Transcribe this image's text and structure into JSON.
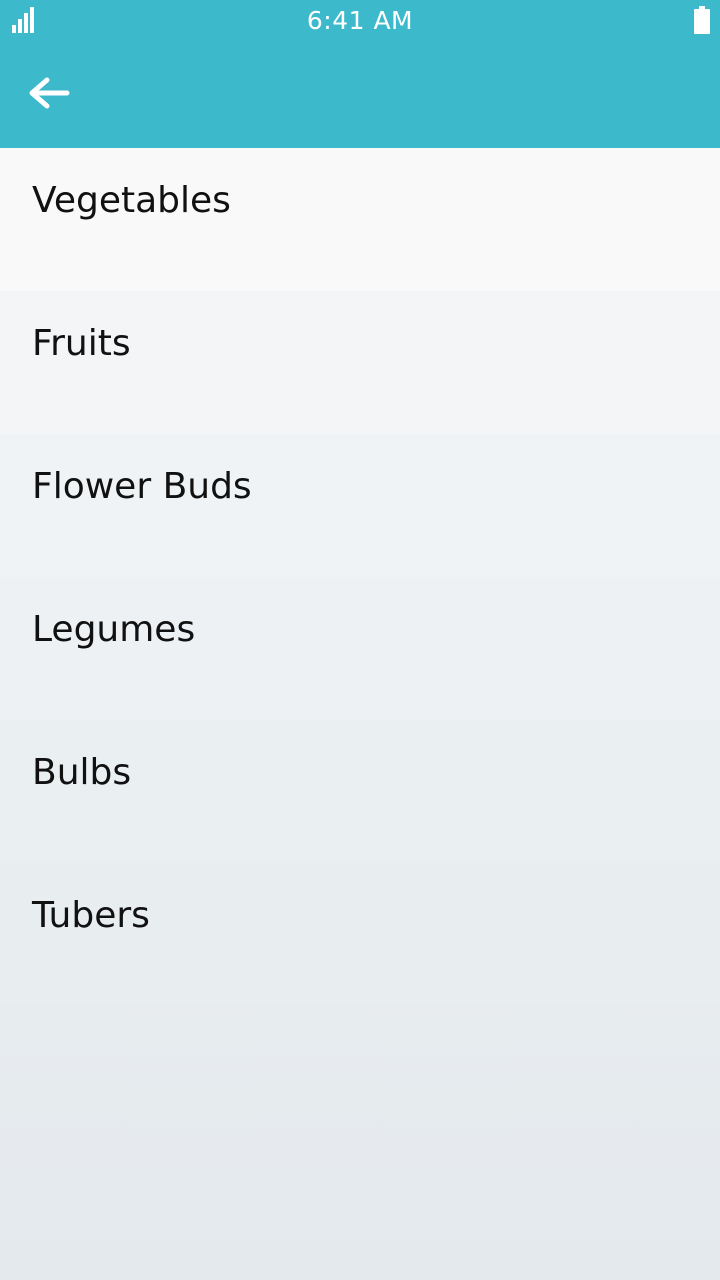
{
  "status_bar": {
    "time": "6:41 AM",
    "signal_icon": "signal-bars-icon",
    "battery_icon": "battery-icon"
  },
  "app_bar": {
    "back_icon": "arrow-left-icon",
    "color": "#3db9cc"
  },
  "list": {
    "items": [
      {
        "label": "Vegetables"
      },
      {
        "label": "Fruits"
      },
      {
        "label": "Flower Buds"
      },
      {
        "label": "Legumes"
      },
      {
        "label": "Bulbs"
      },
      {
        "label": "Tubers"
      }
    ]
  }
}
